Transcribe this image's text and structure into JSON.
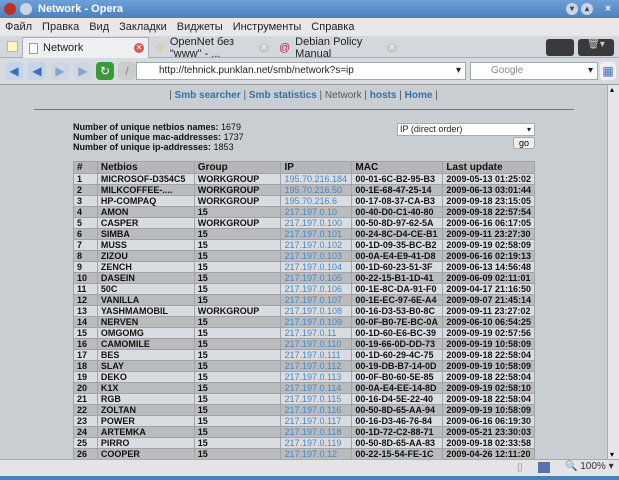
{
  "window": {
    "title": "Network - Opera"
  },
  "menu": [
    "Файл",
    "Правка",
    "Вид",
    "Закладки",
    "Виджеты",
    "Инструменты",
    "Справка"
  ],
  "tabs": [
    {
      "label": "Network"
    },
    {
      "label": "OpenNet без \"www\" - ..."
    },
    {
      "label": "Debian Policy Manual"
    }
  ],
  "address": {
    "url": "http://tehnick.punklan.net/smb/network?s=ip"
  },
  "search": {
    "placeholder": "Google"
  },
  "nav": {
    "links": [
      "Smb searcher",
      "Smb statistics",
      "Network",
      "hosts",
      "Home"
    ],
    "sep": "|"
  },
  "stats": [
    {
      "label": "Number of unique netbios names:",
      "value": "1679"
    },
    {
      "label": "Number of unique mac-addresses:",
      "value": "1737"
    },
    {
      "label": "Number of unique ip-addresses:",
      "value": "1853"
    }
  ],
  "sort": {
    "selected": "IP (direct order)",
    "go": "go"
  },
  "table": {
    "headers": [
      "#",
      "Netbios",
      "Group",
      "IP",
      "MAC",
      "Last update"
    ],
    "rows": [
      [
        "1",
        "MICROSOF-D354C5",
        "WORKGROUP",
        "195.70.216.184",
        "00-01-6C-B2-95-B3",
        "2009-05-13 01:25:02"
      ],
      [
        "2",
        "MILKCOFFEE-....",
        "WORKGROUP",
        "195.70.216.50",
        "00-1E-68-47-25-14",
        "2009-06-13 03:01:44"
      ],
      [
        "3",
        "HP-COMPAQ",
        "WORKGROUP",
        "195.70.216.6",
        "00-17-08-37-CA-B3",
        "2009-09-18 23:15:05"
      ],
      [
        "4",
        "AMON",
        "15",
        "217.197.0.10",
        "00-40-D0-C1-40-80",
        "2009-09-18 22:57:54"
      ],
      [
        "5",
        "CASPER",
        "WORKGROUP",
        "217.197.0.100",
        "00-50-8D-97-62-5A",
        "2009-06-16 06:17:05"
      ],
      [
        "6",
        "SIMBA",
        "15",
        "217.197.0.101",
        "00-24-8C-D4-CE-B1",
        "2009-09-11 23:27:30"
      ],
      [
        "7",
        "MUSS",
        "15",
        "217.197.0.102",
        "00-1D-09-35-BC-B2",
        "2009-09-19 02:58:09"
      ],
      [
        "8",
        "ZIZOU",
        "15",
        "217.197.0.103",
        "00-0A-E4-E9-41-D8",
        "2009-06-16 02:19:13"
      ],
      [
        "9",
        "ZENCH",
        "15",
        "217.197.0.104",
        "00-1D-60-23-51-3F",
        "2009-06-13 14:56:48"
      ],
      [
        "10",
        "DASEIN",
        "15",
        "217.197.0.105",
        "00-22-15-B1-1D-41",
        "2009-06-09 02:11:01"
      ],
      [
        "11",
        "50C",
        "15",
        "217.197.0.106",
        "00-1E-8C-DA-91-F0",
        "2009-04-17 21:16:50"
      ],
      [
        "12",
        "VANILLA",
        "15",
        "217.197.0.107",
        "00-1E-EC-97-6E-A4",
        "2009-09-07 21:45:14"
      ],
      [
        "13",
        "YASHMAMOBIL",
        "WORKGROUP",
        "217.197.0.108",
        "00-16-D3-53-B0-8C",
        "2009-09-11 23:27:02"
      ],
      [
        "14",
        "NERVEN",
        "15",
        "217.197.0.109",
        "00-0F-B0-7E-BC-0A",
        "2009-06-10 06:54:25"
      ],
      [
        "15",
        "OMGOMG",
        "15",
        "217.197.0.11",
        "00-1D-60-E6-BC-39",
        "2009-09-19 02:57:56"
      ],
      [
        "16",
        "CAMOMILE",
        "15",
        "217.197.0.110",
        "00-19-66-0D-DD-73",
        "2009-09-19 10:58:09"
      ],
      [
        "17",
        "BES",
        "15",
        "217.197.0.111",
        "00-1D-60-29-4C-75",
        "2009-09-18 22:58:04"
      ],
      [
        "18",
        "SLAY",
        "15",
        "217.197.0.112",
        "00-19-DB-B7-14-0D",
        "2009-09-19 10:58:09"
      ],
      [
        "19",
        "DEKO",
        "15",
        "217.197.0.113",
        "00-0F-B0-60-5E-85",
        "2009-09-18 22:58:04"
      ],
      [
        "20",
        "K1X",
        "15",
        "217.197.0.114",
        "00-0A-E4-EE-14-8D",
        "2009-09-19 02:58:10"
      ],
      [
        "21",
        "RGB",
        "15",
        "217.197.0.115",
        "00-16-D4-5E-22-40",
        "2009-09-18 22:58:04"
      ],
      [
        "22",
        "ZOLTAN",
        "15",
        "217.197.0.116",
        "00-50-8D-65-AA-94",
        "2009-09-19 10:58:09"
      ],
      [
        "23",
        "POWER",
        "15",
        "217.197.0.117",
        "00-16-D3-46-76-84",
        "2009-06-16 06:19:30"
      ],
      [
        "24",
        "ARTEMKA",
        "15",
        "217.197.0.118",
        "00-1D-72-C2-88-71",
        "2009-05-21 23:30:03"
      ],
      [
        "25",
        "PIRRO",
        "15",
        "217.197.0.119",
        "00-50-8D-65-AA-83",
        "2009-09-18 02:33:58"
      ],
      [
        "26",
        "COOPER",
        "15",
        "217.197.0.12",
        "00-22-15-54-FE-1C",
        "2009-04-26 12:11:20"
      ]
    ]
  },
  "statusbar": {
    "zoom": "100%"
  }
}
